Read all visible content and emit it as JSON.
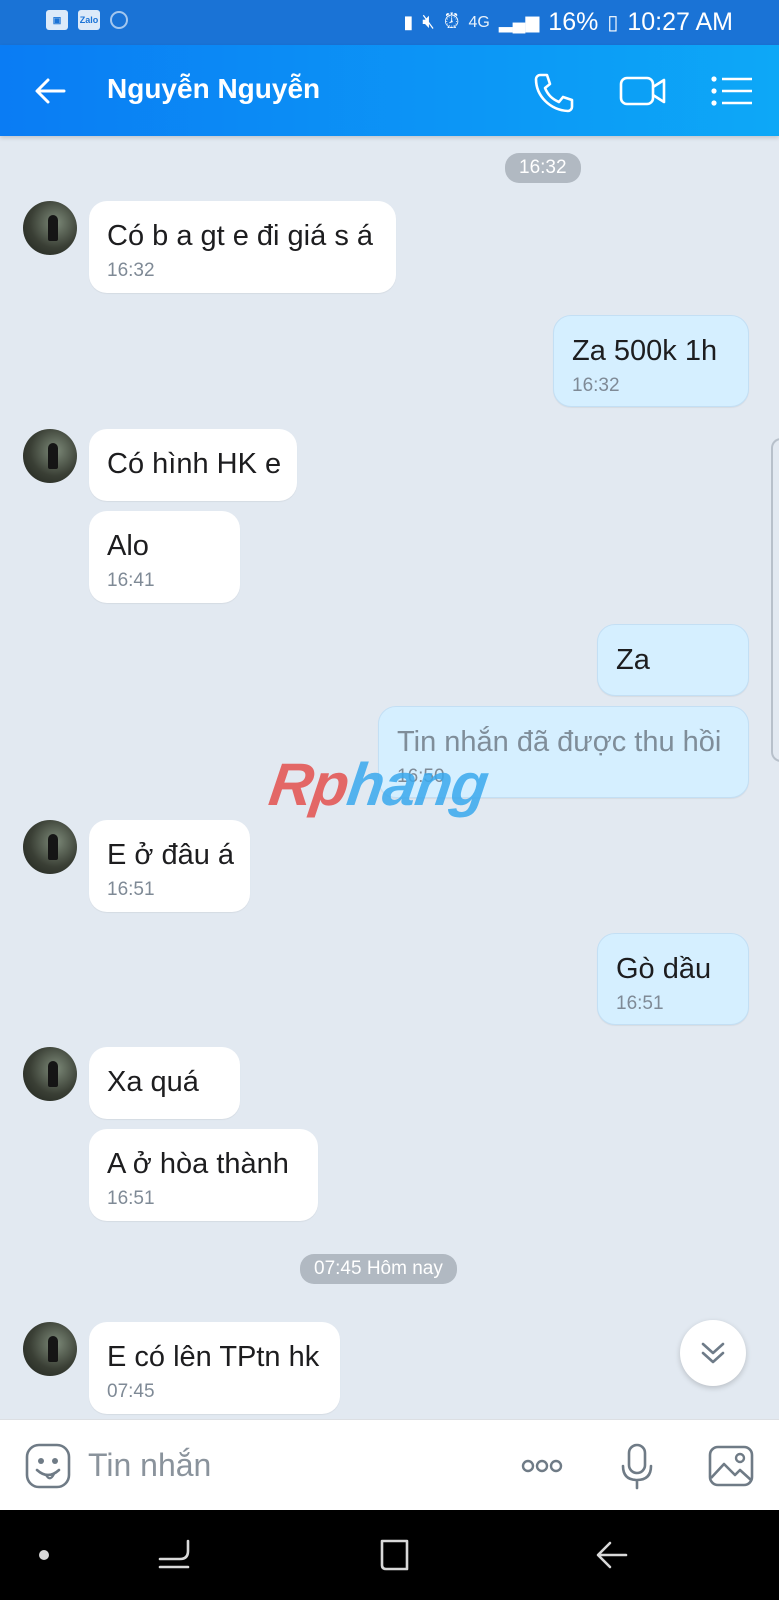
{
  "status_bar": {
    "left_icons": [
      "image-icon",
      "zalo-icon",
      "hotspot-icon"
    ],
    "zalo_label": "Zalo",
    "network": "4G",
    "battery": "16%",
    "time": "10:27 AM"
  },
  "header": {
    "title": "Nguyễn Nguyễn",
    "actions": [
      "phone-icon",
      "video-icon",
      "menu-icon"
    ]
  },
  "chat": {
    "separators": [
      "16:32",
      "07:45 Hôm nay"
    ],
    "messages": [
      {
        "side": "in",
        "text": "Có b a gt e đi giá s á",
        "time": "16:32"
      },
      {
        "side": "out",
        "text": "Za 500k 1h",
        "time": "16:32"
      },
      {
        "side": "in",
        "text": "Có hình HK e",
        "time": ""
      },
      {
        "side": "in",
        "text": "Alo",
        "time": "16:41"
      },
      {
        "side": "out",
        "text": "Za",
        "time": ""
      },
      {
        "side": "out",
        "text": "Tin nhắn đã được thu hồi",
        "time": "16:50"
      },
      {
        "side": "in",
        "text": "E ở đâu á",
        "time": "16:51"
      },
      {
        "side": "out",
        "text": "Gò dầu",
        "time": "16:51"
      },
      {
        "side": "in",
        "text": "Xa quá",
        "time": ""
      },
      {
        "side": "in",
        "text": "A ở hòa thành",
        "time": "16:51"
      },
      {
        "side": "in",
        "text": "E có lên TPtn hk",
        "time": "07:45"
      }
    ]
  },
  "watermark": {
    "part1": "Rp",
    "part2": "hang"
  },
  "composer": {
    "placeholder": "Tin nhắn",
    "icons": [
      "sticker-icon",
      "more-icon",
      "microphone-icon",
      "gallery-icon"
    ]
  },
  "colors": {
    "header_start": "#0a7cf4",
    "header_end": "#0da8f7",
    "incoming_bubble": "#ffffff",
    "outgoing_bubble": "#d5efff",
    "chat_background": "#e2e9f1"
  }
}
